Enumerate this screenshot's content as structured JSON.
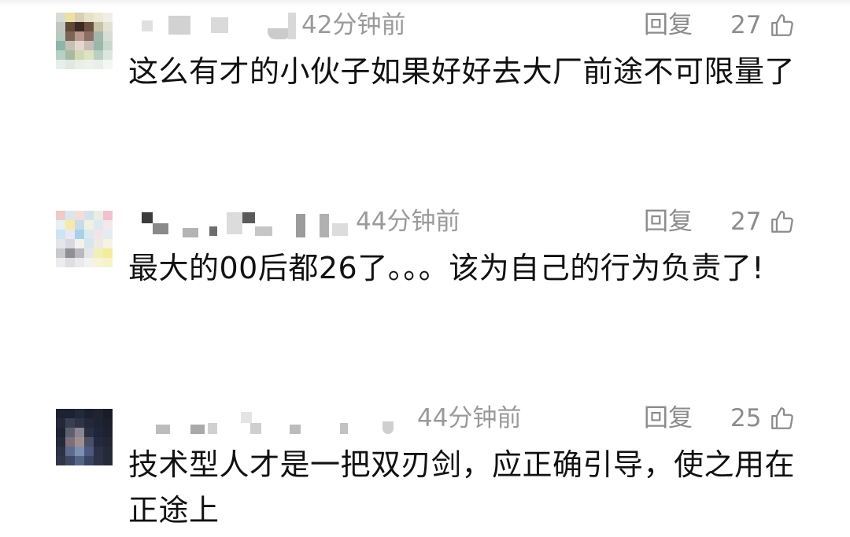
{
  "colors": {
    "meta_text": "#9a9a9a",
    "body_text": "#111111",
    "background": "#ffffff"
  },
  "comments": [
    {
      "time": "42分钟前",
      "reply_label": "回复",
      "likes": "27",
      "text": "这么有才的小伙子如果好好去大厂前途不可限量了",
      "like_icon": "thumbs-up-outline-icon"
    },
    {
      "time": "44分钟前",
      "reply_label": "回复",
      "likes": "27",
      "text": "最大的00后都26了。。。该为自己的行为负责了!",
      "like_icon": "thumbs-up-outline-icon"
    },
    {
      "time": "44分钟前",
      "reply_label": "回复",
      "likes": "25",
      "text": "技术型人才是一把双刃剑，应正确引导，使之用在正途上",
      "like_icon": "thumbs-up-outline-icon"
    }
  ]
}
